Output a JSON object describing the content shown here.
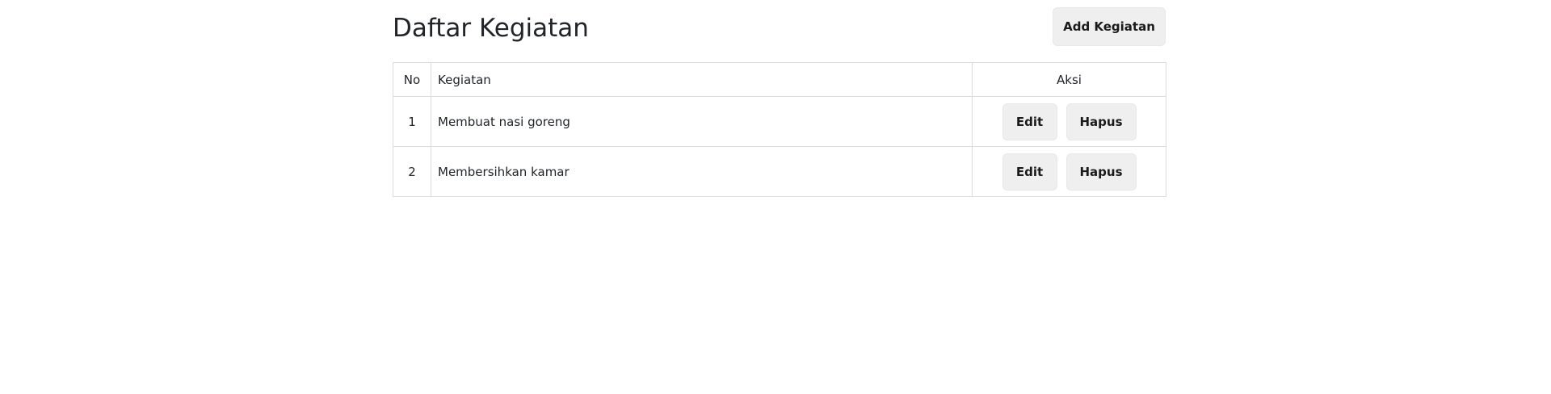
{
  "header": {
    "title": "Daftar Kegiatan",
    "add_label": "Add Kegiatan"
  },
  "table": {
    "columns": [
      "No",
      "Kegiatan",
      "Aksi"
    ],
    "rows": [
      {
        "no": "1",
        "kegiatan": "Membuat nasi goreng",
        "edit_label": "Edit",
        "delete_label": "Hapus"
      },
      {
        "no": "2",
        "kegiatan": "Membersihkan kamar",
        "edit_label": "Edit",
        "delete_label": "Hapus"
      }
    ]
  }
}
